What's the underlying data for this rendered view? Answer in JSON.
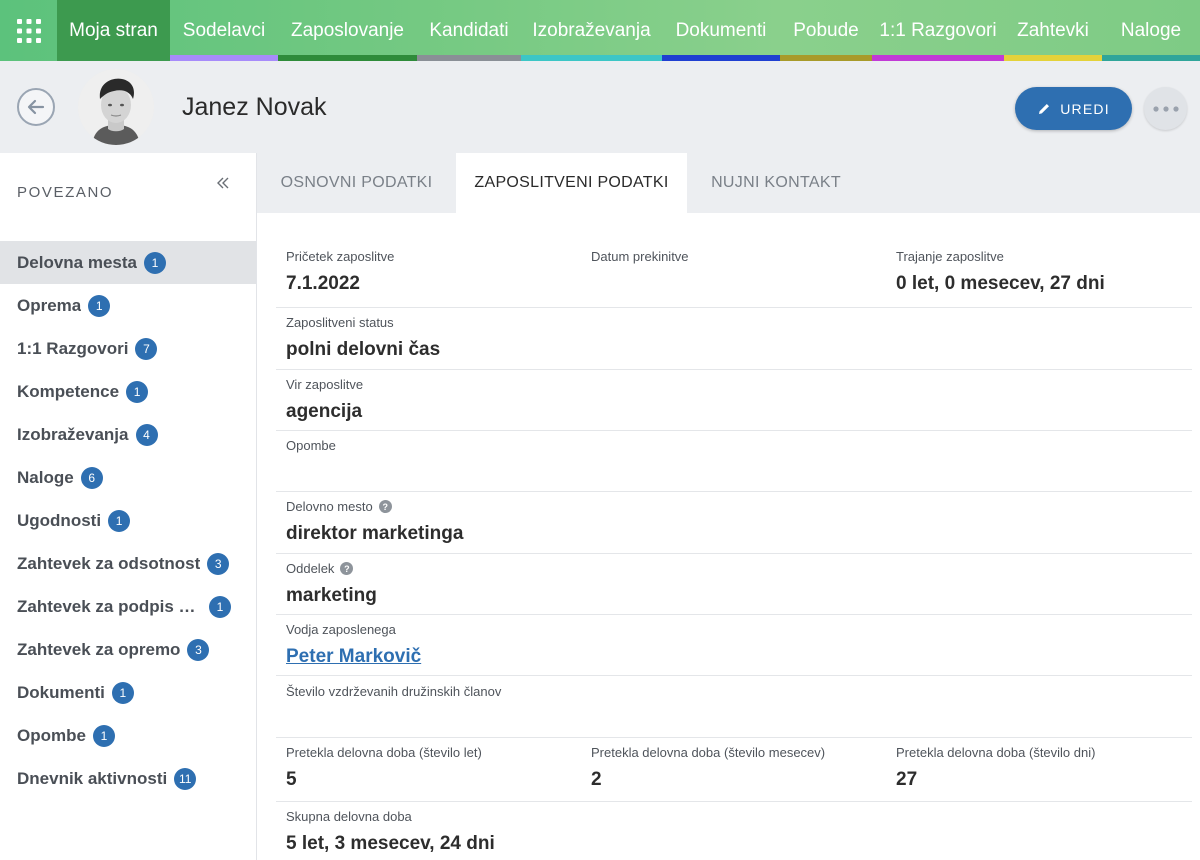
{
  "topnav": {
    "items": [
      {
        "label": "Moja stran",
        "color": "#3d9a4f"
      },
      {
        "label": "Sodelavci",
        "color": "#a78bfa"
      },
      {
        "label": "Zaposlovanje",
        "color": "#2e8b3a"
      },
      {
        "label": "Kandidati",
        "color": "#8a8f96"
      },
      {
        "label": "Izobraževanja",
        "color": "#3cc6c6"
      },
      {
        "label": "Dokumenti",
        "color": "#1f3fd1"
      },
      {
        "label": "Pobude",
        "color": "#a89a2a"
      },
      {
        "label": "1:1 Razgovori",
        "color": "#c13ad6"
      },
      {
        "label": "Zahtevki",
        "color": "#e4d23a"
      },
      {
        "label": "Naloge",
        "color": "#2fa59a"
      }
    ]
  },
  "header": {
    "name": "Janez Novak",
    "edit_label": "UREDI"
  },
  "sidebar": {
    "title": "POVEZANO",
    "items": [
      {
        "label": "Delovna mesta",
        "count": "1"
      },
      {
        "label": "Oprema",
        "count": "1"
      },
      {
        "label": "1:1 Razgovori",
        "count": "7"
      },
      {
        "label": "Kompetence",
        "count": "1"
      },
      {
        "label": "Izobraževanja",
        "count": "4"
      },
      {
        "label": "Naloge",
        "count": "6"
      },
      {
        "label": "Ugodnosti",
        "count": "1"
      },
      {
        "label": "Zahtevek za odsotnost",
        "count": "3"
      },
      {
        "label": "Zahtevek za podpis d...",
        "count": "1"
      },
      {
        "label": "Zahtevek za opremo",
        "count": "3"
      },
      {
        "label": "Dokumenti",
        "count": "1"
      },
      {
        "label": "Opombe",
        "count": "1"
      },
      {
        "label": "Dnevnik aktivnosti",
        "count": "11"
      }
    ]
  },
  "tabs": [
    {
      "label": "OSNOVNI PODATKI"
    },
    {
      "label": "ZAPOSLITVENI PODATKI"
    },
    {
      "label": "NUJNI KONTAKT"
    }
  ],
  "fields": {
    "start_date": {
      "label": "Pričetek zaposlitve",
      "value": "7.1.2022"
    },
    "end_date": {
      "label": "Datum prekinitve",
      "value": ""
    },
    "duration": {
      "label": "Trajanje zaposlitve",
      "value": "0 let, 0 mesecev, 27 dni"
    },
    "status": {
      "label": "Zaposlitveni status",
      "value": "polni delovni čas"
    },
    "source": {
      "label": "Vir zaposlitve",
      "value": "agencija"
    },
    "notes": {
      "label": "Opombe",
      "value": ""
    },
    "position": {
      "label": "Delovno mesto",
      "value": "direktor marketinga"
    },
    "department": {
      "label": "Oddelek",
      "value": "marketing"
    },
    "manager": {
      "label": "Vodja zaposlenega",
      "value": "Peter Markovič"
    },
    "dependents": {
      "label": "Število vzdrževanih družinskih članov",
      "value": ""
    },
    "exp_years": {
      "label": "Pretekla delovna doba (število let)",
      "value": "5"
    },
    "exp_months": {
      "label": "Pretekla delovna doba (število mesecev)",
      "value": "2"
    },
    "exp_days": {
      "label": "Pretekla delovna doba (število dni)",
      "value": "27"
    },
    "total": {
      "label": "Skupna delovna doba",
      "value": "5 let, 3 mesecev, 24 dni"
    }
  }
}
